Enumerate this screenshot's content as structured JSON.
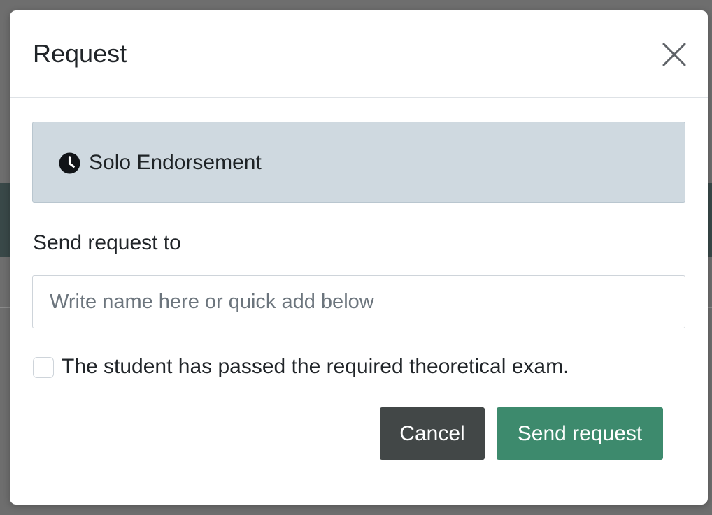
{
  "modal": {
    "title": "Request",
    "close_icon": "close-icon"
  },
  "alert": {
    "icon": "clock-icon",
    "text": "Solo Endorsement"
  },
  "recipient": {
    "label": "Send request to",
    "value": "",
    "placeholder": "Write name here or quick add below"
  },
  "exam_checkbox": {
    "checked": false,
    "label": "The student has passed the required theoretical exam."
  },
  "buttons": {
    "cancel_label": "Cancel",
    "send_label": "Send request"
  },
  "colors": {
    "alert_background": "#cfd9e0",
    "cancel_button": "#424747",
    "send_button": "#3d8a6d"
  }
}
